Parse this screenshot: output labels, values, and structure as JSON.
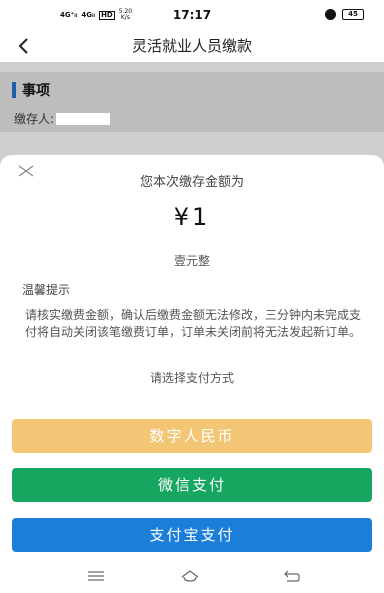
{
  "status_bar": {
    "signal1": "4G⁺ᵢₗ",
    "signal2": "4Gᵢₗ",
    "hd": "HD",
    "speed_value": "5.20",
    "speed_unit": "K/s",
    "time": "17:17",
    "battery": "45"
  },
  "nav": {
    "title": "灵活就业人员缴款"
  },
  "section": {
    "title": "事项",
    "payer_label": "缴存人:"
  },
  "sheet": {
    "amount_label": "您本次缴存金额为",
    "amount": "¥1",
    "amount_words": "壹元整",
    "tips_title": "温馨提示",
    "tips_text": "请核实缴费金额，确认后缴费金额无法修改，三分钟内未完成支付将自动关闭该笔缴费订单，订单未关闭前将无法发起新订单。",
    "pay_prompt": "请选择支付方式",
    "buttons": {
      "rmb": "数字人民币",
      "wechat": "微信支付",
      "alipay": "支付宝支付"
    }
  },
  "colors": {
    "rmb_button": "#f3c675",
    "wechat_button": "#16a660",
    "alipay_button": "#1b7fd9",
    "section_accent": "#1e5fa8"
  }
}
